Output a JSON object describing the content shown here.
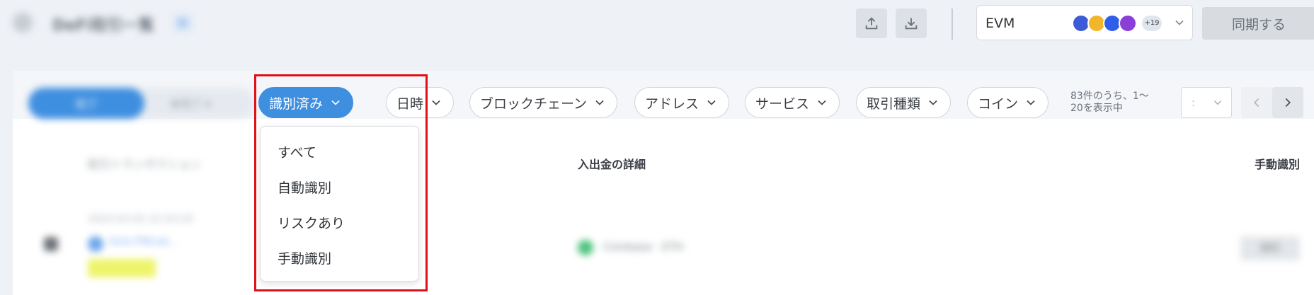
{
  "header": {
    "page_title": "DeFi取引一覧",
    "title_badge": "β",
    "upload_icon": "upload-icon",
    "download_icon": "download-icon",
    "chain_selector": {
      "label": "EVM",
      "icons": [
        "ethereum-icon",
        "bnb-icon",
        "celo-icon",
        "polygon-icon"
      ],
      "more_count": "+19"
    },
    "sync_button": "同期する"
  },
  "tabs": {
    "active": "完了",
    "inactive": "未完了 ▾"
  },
  "filters": [
    {
      "label": "識別済み",
      "active": true
    },
    {
      "label": "日時",
      "active": false
    },
    {
      "label": "ブロックチェーン",
      "active": false
    },
    {
      "label": "アドレス",
      "active": false
    },
    {
      "label": "サービス",
      "active": false
    },
    {
      "label": "取引種類",
      "active": false
    },
    {
      "label": "コイン",
      "active": false
    }
  ],
  "pagination": {
    "summary_line1": "83件のうち、1〜",
    "summary_line2": "20を表示中",
    "page_size": ":"
  },
  "table": {
    "headers": {
      "transaction": "取引トランザクション",
      "details": "入出金の詳細",
      "manual": "手動識別"
    },
    "row": {
      "date": "2023-03-02 21:53:24",
      "address": "0x5c7f9Ca4...",
      "detail": "Coinbase · ETH",
      "action": "識別"
    }
  },
  "dropdown": {
    "items": [
      "すべて",
      "自動識別",
      "リスクあり",
      "手動識別"
    ]
  },
  "colors": {
    "accent": "#3f8fe0",
    "highlight": "#e0101a"
  }
}
